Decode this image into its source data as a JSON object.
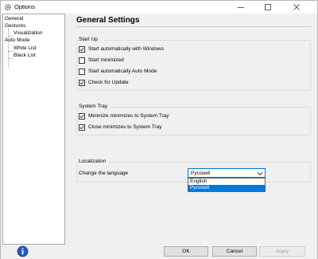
{
  "window": {
    "title": "Options",
    "accent": "#0078d7"
  },
  "tree": {
    "items": [
      {
        "label": "General",
        "level": 0
      },
      {
        "label": "Gestures",
        "level": 0
      },
      {
        "label": "Visualization",
        "level": 1
      },
      {
        "label": "Auto Mode",
        "level": 0
      },
      {
        "label": "White List",
        "level": 1
      },
      {
        "label": "Black List",
        "level": 1
      }
    ]
  },
  "page": {
    "title": "General Settings"
  },
  "startup": {
    "label": "Start Up",
    "options": [
      {
        "label": "Start automatically with Windows",
        "checked": true
      },
      {
        "label": "Start minimized",
        "checked": false
      },
      {
        "label": "Start automatically Auto Mode",
        "checked": false
      },
      {
        "label": "Check for Update",
        "checked": true
      }
    ]
  },
  "tray": {
    "label": "System Tray",
    "options": [
      {
        "label": "Minimize minimizes to System Tray",
        "checked": true
      },
      {
        "label": "Close minimizes to System Tray",
        "checked": true
      }
    ]
  },
  "localization": {
    "label": "Localization",
    "language_label": "Change the language",
    "selected": "Русский",
    "options": [
      "English",
      "Русский"
    ]
  },
  "buttons": {
    "ok": "OK",
    "cancel": "Cancel",
    "apply": "Apply"
  },
  "icons": {
    "app": "gear-icon",
    "info": "info-icon"
  }
}
